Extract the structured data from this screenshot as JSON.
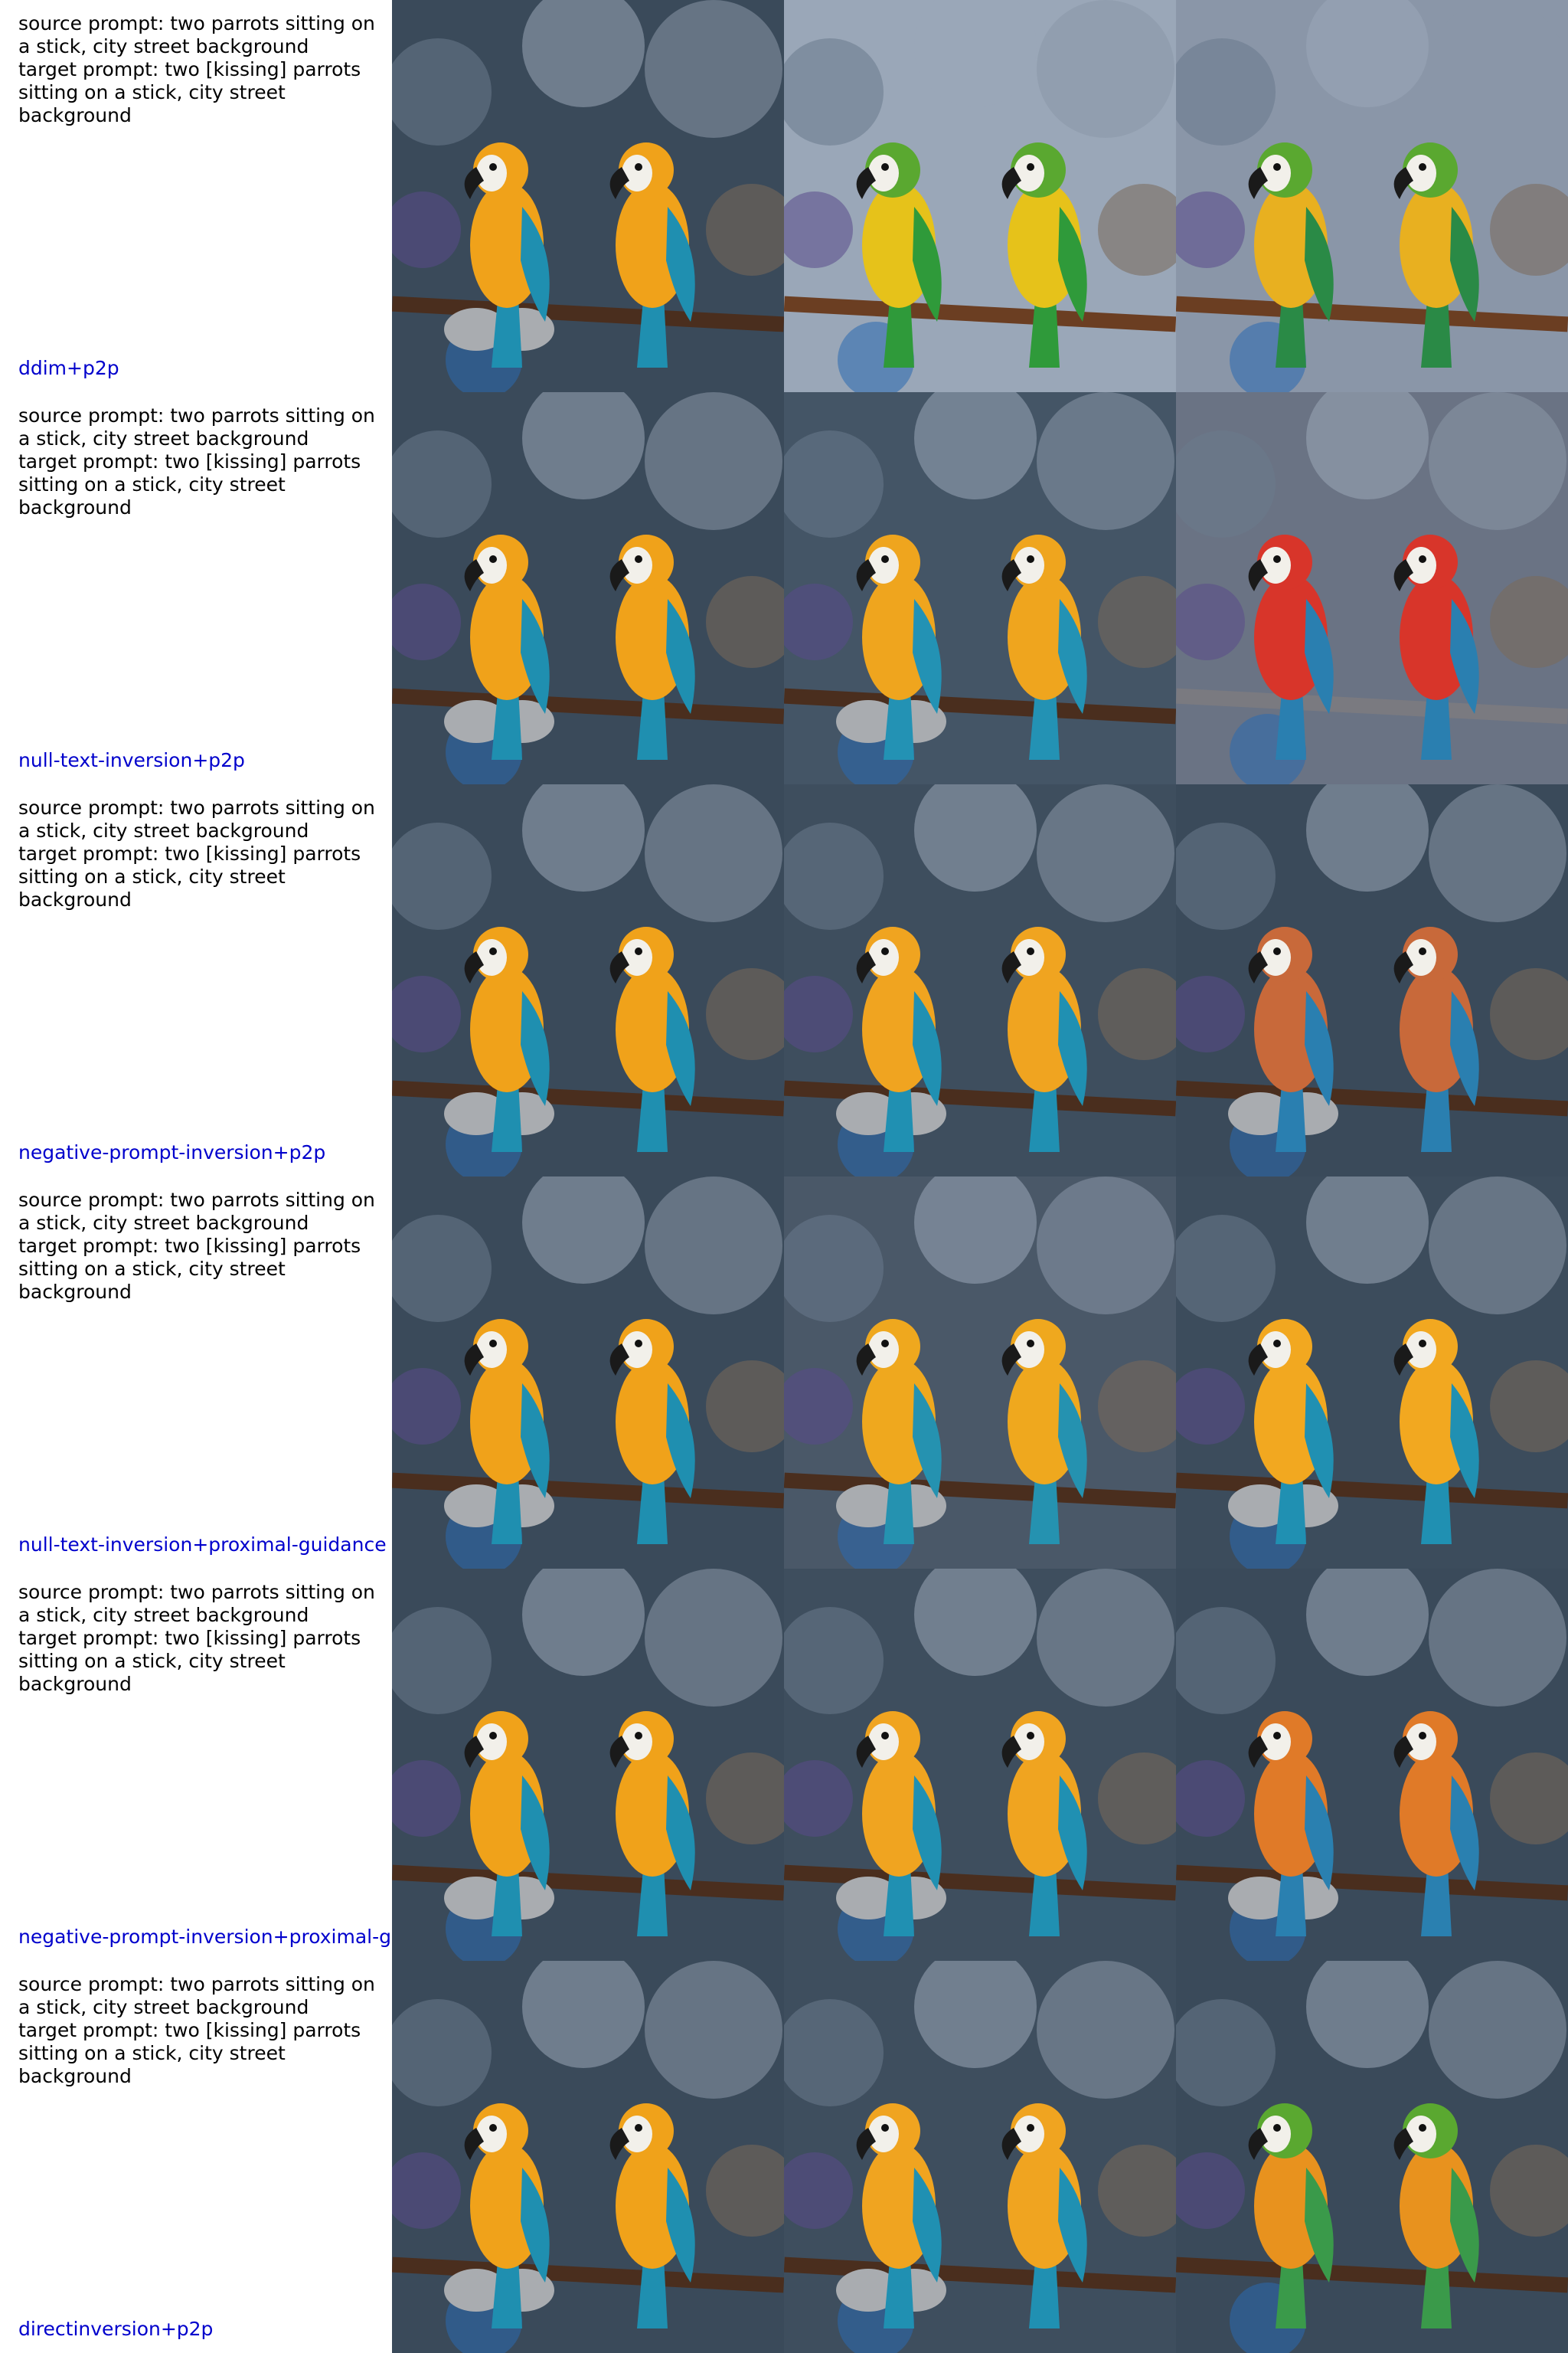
{
  "source_prompt": "source prompt: two parrots sitting on\na stick, city street background",
  "target_prompt": "target prompt: two [kissing] parrots\nsitting on a stick, city street\nbackground",
  "target_prompt_row1": "target prompt: two [kissing] parrots\nsitting on a stick, city street\nbackground",
  "target_prompt_row1_alt": "target prompt: two [kissing] parrots\nsitting on a stick, city street\nbackground",
  "rows": [
    {
      "method": "ddim+p2p",
      "source": "source prompt: two parrots sitting on\na stick, city street background",
      "target": "target prompt: two [kissing] parrots\nsitting on a stick, city street\nbackground",
      "images": [
        {
          "style": "original",
          "bg": "#3a4a5a",
          "body": "#f0a21a",
          "wing": "#1f8fb0",
          "perch": "#4a2e1e"
        },
        {
          "style": "green-yellow",
          "bg": "#9aa7b8",
          "body": "#e6c21a",
          "wing": "#2f9a3a",
          "perch": "#6b3e22"
        },
        {
          "style": "green-orange",
          "bg": "#8a96a8",
          "body": "#e8b020",
          "wing": "#2a8a46",
          "perch": "#6b3e22"
        }
      ]
    },
    {
      "method": "null-text-inversion+p2p",
      "source": "source prompt: two parrots sitting on\na stick, city street background",
      "target": "target prompt: two [kissing] parrots\nsitting on a stick, city street\nbackground",
      "images": [
        {
          "style": "original",
          "bg": "#3a4a5a",
          "body": "#f0a21a",
          "wing": "#1f8fb0",
          "perch": "#4a2e1e"
        },
        {
          "style": "original",
          "bg": "#445566",
          "body": "#efa51e",
          "wing": "#2392b4",
          "perch": "#4a2e1e"
        },
        {
          "style": "red",
          "bg": "#6a7384",
          "body": "#d8352a",
          "wing": "#2a7fb0",
          "perch": "#7a7a80"
        }
      ]
    },
    {
      "method": "negative-prompt-inversion+p2p",
      "source": "source prompt: two parrots sitting on\na stick, city street background",
      "target": "target prompt: two [kissing] parrots\nsitting on a stick, city street\nbackground",
      "images": [
        {
          "style": "original",
          "bg": "#3a4a5a",
          "body": "#f0a21a",
          "wing": "#1f8fb0",
          "perch": "#4a2e1e"
        },
        {
          "style": "original",
          "bg": "#3e4e5e",
          "body": "#f0a420",
          "wing": "#2090b2",
          "perch": "#4a2e1e"
        },
        {
          "style": "rust",
          "bg": "#3a4a5a",
          "body": "#c8693a",
          "wing": "#2a7fb0",
          "perch": "#4a2e1e"
        }
      ]
    },
    {
      "method": "null-text-inversion+proximal-guidance",
      "source": "source prompt: two parrots sitting on\na stick, city street background",
      "target": "target prompt: two [kissing] parrots\nsitting on a stick, city street\nbackground",
      "images": [
        {
          "style": "original",
          "bg": "#3a4a5a",
          "body": "#f0a21a",
          "wing": "#1f8fb0",
          "perch": "#4a2e1e"
        },
        {
          "style": "original",
          "bg": "#4a5868",
          "body": "#efa81e",
          "wing": "#2592b0",
          "perch": "#4a2e1e"
        },
        {
          "style": "original",
          "bg": "#3c4c5c",
          "body": "#f2a820",
          "wing": "#2090b2",
          "perch": "#4a2e1e"
        }
      ]
    },
    {
      "method": "negative-prompt-inversion+proximal-g",
      "source": "source prompt: two parrots sitting on\na stick, city street background",
      "target": "target prompt: two [kissing] parrots\nsitting on a stick, city street\nbackground",
      "images": [
        {
          "style": "original",
          "bg": "#3a4a5a",
          "body": "#f0a21a",
          "wing": "#1f8fb0",
          "perch": "#4a2e1e"
        },
        {
          "style": "original",
          "bg": "#3e4e5e",
          "body": "#f0a420",
          "wing": "#2090b2",
          "perch": "#4a2e1e"
        },
        {
          "style": "orange",
          "bg": "#3a4a5a",
          "body": "#e07a28",
          "wing": "#2a80b0",
          "perch": "#4a2e1e"
        }
      ]
    },
    {
      "method": "directinversion+p2p",
      "source": "source prompt: two parrots sitting on\na stick, city street background",
      "target": "target prompt: two [kissing] parrots\nsitting on a stick, city street\nbackground",
      "images": [
        {
          "style": "original",
          "bg": "#3a4a5a",
          "body": "#f0a21a",
          "wing": "#1f8fb0",
          "perch": "#4a2e1e"
        },
        {
          "style": "original",
          "bg": "#3e4e5e",
          "body": "#f0a420",
          "wing": "#2090b2",
          "perch": "#4a2e1e"
        },
        {
          "style": "green-orange",
          "bg": "#3a4a5a",
          "body": "#e8921e",
          "wing": "#3a9a4a",
          "perch": "#4a2e1e"
        }
      ]
    }
  ]
}
